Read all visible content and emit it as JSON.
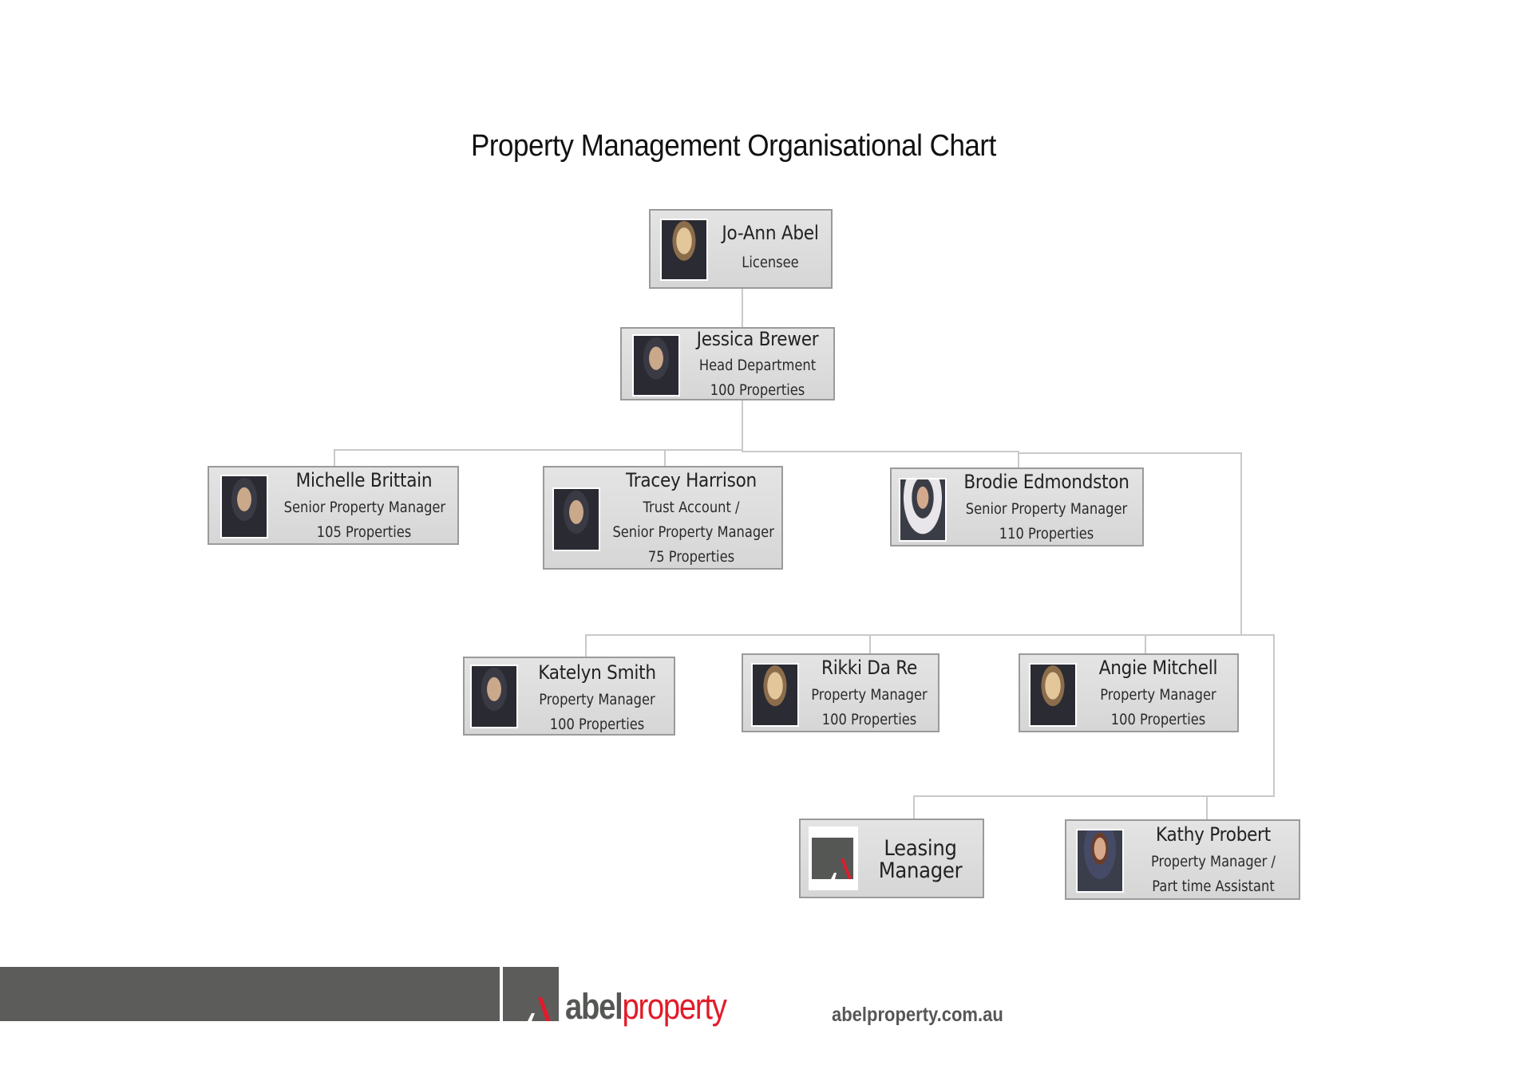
{
  "title": "Property Management Organisational Chart",
  "people": [
    {
      "name": "Jo-Ann Abel",
      "role": "Licensee"
    },
    {
      "name": "Jessica Brewer",
      "role": "Head Department",
      "properties": "100 Properties"
    },
    {
      "name": "Michelle Brittain",
      "role": "Senior Property Manager",
      "properties": "105 Properties"
    },
    {
      "name": "Tracey Harrison",
      "role": "Trust Account /",
      "role2": "Senior Property Manager",
      "properties": "75 Properties"
    },
    {
      "name": "Brodie Edmondston",
      "role": "Senior Property Manager",
      "properties": "110 Properties"
    },
    {
      "name": "Katelyn Smith",
      "role": "Property Manager",
      "properties": "100 Properties"
    },
    {
      "name": "Rikki Da Re",
      "role": "Property Manager",
      "properties": "100 Properties"
    },
    {
      "name": "Angie Mitchell",
      "role": "Property Manager",
      "properties": "100 Properties"
    },
    {
      "name": "Leasing",
      "role": "Manager"
    },
    {
      "name": "Kathy Probert",
      "role": "Property Manager /",
      "role2": "Part time Assistant"
    }
  ],
  "icons": {
    "photo": "person-photo",
    "placeholder": "abel-logo-placeholder-icon"
  },
  "footer": {
    "brand_part1": "abel",
    "brand_part2": "property",
    "url": "abelproperty.com.au"
  },
  "colors": {
    "brand_grey": "#5c5d5b",
    "brand_red": "#e21b2a",
    "card_fill": "#dcdcdc",
    "card_border": "#9a9a9a",
    "connector": "#c9c9c9"
  }
}
